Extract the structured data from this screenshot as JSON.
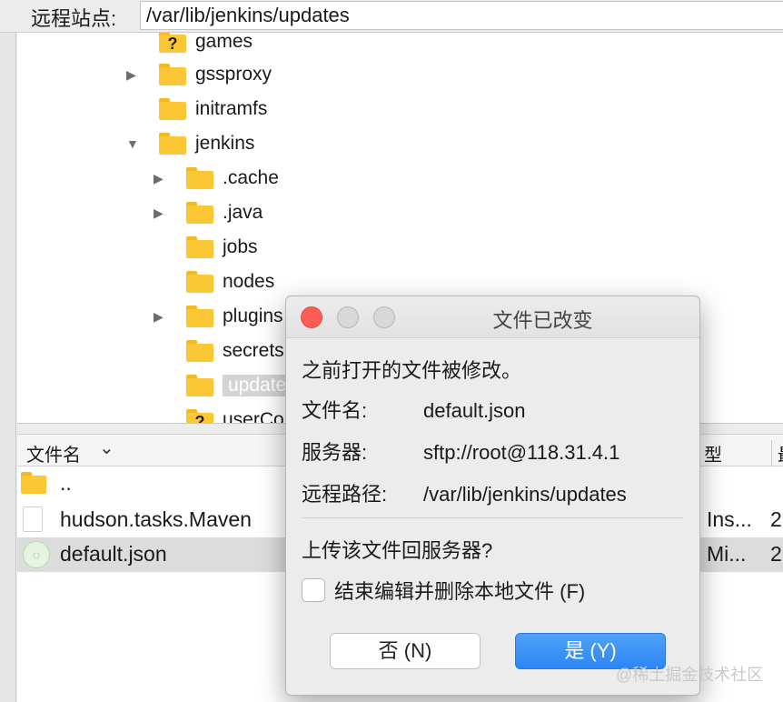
{
  "path_bar": {
    "label": "远程站点:",
    "value": "/var/lib/jenkins/updates"
  },
  "tree": {
    "items": [
      {
        "label": "games"
      },
      {
        "label": "gssproxy"
      },
      {
        "label": "initramfs"
      },
      {
        "label": "jenkins"
      },
      {
        "label": ".cache"
      },
      {
        "label": ".java"
      },
      {
        "label": "jobs"
      },
      {
        "label": "nodes"
      },
      {
        "label": "plugins"
      },
      {
        "label": "secrets"
      },
      {
        "label": "updates"
      },
      {
        "label": "userCo"
      }
    ]
  },
  "file_list": {
    "header_name": "文件名",
    "header_type": "型",
    "header_extra": "最",
    "rows": [
      {
        "name": "..",
        "type": "",
        "extra": ""
      },
      {
        "name": "hudson.tasks.Maven",
        "type": "Ins...",
        "extra": "2"
      },
      {
        "name": "default.json",
        "type": "Mi...",
        "extra": "2"
      }
    ]
  },
  "dialog": {
    "title": "文件已改变",
    "message": "之前打开的文件被修改。",
    "fields": [
      {
        "key": "文件名:",
        "value": "default.json"
      },
      {
        "key": "服务器:",
        "value": "sftp://root@118.31.4.1"
      },
      {
        "key": "远程路径:",
        "value": "/var/lib/jenkins/updates"
      }
    ],
    "question": "上传该文件回服务器?",
    "checkbox_label": "结束编辑并删除本地文件 (F)",
    "checkbox_checked": false,
    "no_button": "否 (N)",
    "yes_button": "是 (Y)",
    "accent_color": "#2c86f3"
  },
  "watermark": "@稀土掘金技术社区"
}
